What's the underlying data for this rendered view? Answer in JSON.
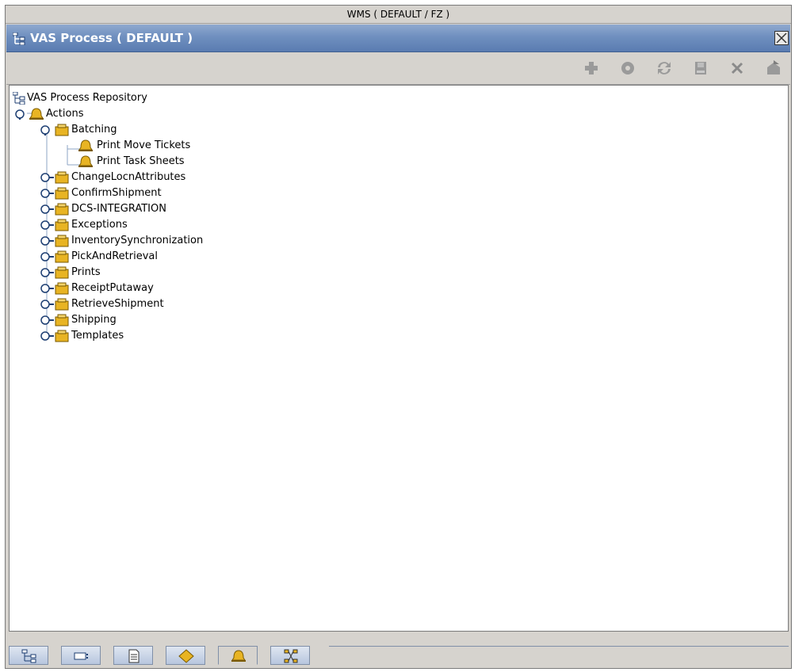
{
  "app": {
    "window_title": "WMS ( DEFAULT / FZ )"
  },
  "panel": {
    "title": "VAS Process ( DEFAULT )",
    "close_icon": "close-icon"
  },
  "toolbar": {
    "buttons": [
      {
        "name": "add-icon"
      },
      {
        "name": "details-icon"
      },
      {
        "name": "refresh-icon"
      },
      {
        "name": "save-icon"
      },
      {
        "name": "delete-icon"
      },
      {
        "name": "export-icon"
      }
    ]
  },
  "tree": {
    "root": "VAS Process Repository",
    "actions": "Actions",
    "batching": "Batching",
    "batching_children": [
      "Print Move Tickets",
      "Print Task Sheets"
    ],
    "groups": [
      "ChangeLocnAttributes",
      "ConfirmShipment",
      "DCS-INTEGRATION",
      "Exceptions",
      "InventorySynchronization",
      "PickAndRetrieval",
      "Prints",
      "ReceiptPutaway",
      "RetrieveShipment",
      "Shipping",
      "Templates"
    ]
  },
  "bottom_tabs": [
    {
      "name": "tree-icon"
    },
    {
      "name": "field-icon"
    },
    {
      "name": "document-icon"
    },
    {
      "name": "diamond-icon"
    },
    {
      "name": "bell-icon",
      "active": true
    },
    {
      "name": "network-icon"
    }
  ],
  "colors": {
    "header": "#6f8fbf",
    "tree_line": "#8ea4c4",
    "folder": "#e8b423"
  }
}
